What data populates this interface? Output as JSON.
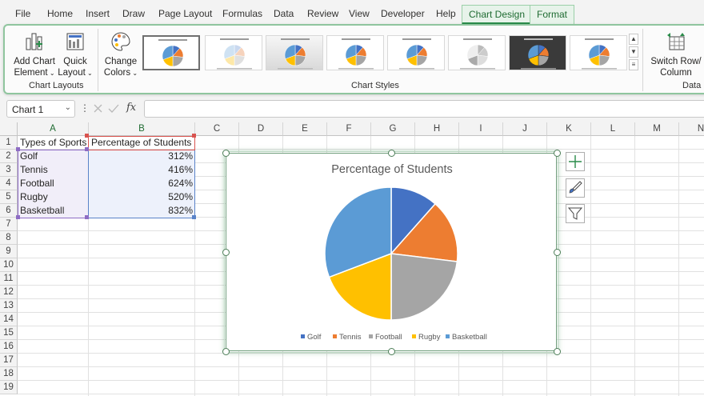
{
  "menu": {
    "tabs": [
      "File",
      "Home",
      "Insert",
      "Draw",
      "Page Layout",
      "Formulas",
      "Data",
      "Review",
      "View",
      "Developer",
      "Help"
    ],
    "context_tabs": [
      "Chart Design",
      "Format"
    ],
    "active_tab": "Chart Design"
  },
  "ribbon": {
    "add_chart_element": [
      "Add Chart",
      "Element"
    ],
    "quick_layout": [
      "Quick",
      "Layout"
    ],
    "change_colors": [
      "Change",
      "Colors"
    ],
    "switch_row_column": [
      "Switch Row/",
      "Column"
    ],
    "groups": {
      "chart_layouts": "Chart Layouts",
      "chart_styles": "Chart Styles",
      "data": "Data"
    },
    "style_count": 8,
    "selected_style": 1
  },
  "formula_bar": {
    "name_box": "Chart 1",
    "fx": "fx",
    "formula": ""
  },
  "sheet": {
    "columns": [
      "A",
      "B",
      "C",
      "D",
      "E",
      "F",
      "G",
      "H",
      "I",
      "J",
      "K",
      "L",
      "M",
      "N"
    ],
    "rows": [
      "1",
      "2",
      "3",
      "4",
      "5",
      "6",
      "7",
      "8",
      "9",
      "10",
      "11",
      "12",
      "13",
      "14",
      "15",
      "16",
      "17",
      "18",
      "19"
    ],
    "headers": [
      "Types of Sports",
      "Percentage of Students"
    ],
    "data": [
      {
        "sport": "Golf",
        "pct": "312%"
      },
      {
        "sport": "Tennis",
        "pct": "416%"
      },
      {
        "sport": "Football",
        "pct": "624%"
      },
      {
        "sport": "Rugby",
        "pct": "520%"
      },
      {
        "sport": "Basketball",
        "pct": "832%"
      }
    ]
  },
  "chart_data": {
    "type": "pie",
    "title": "Percentage of Students",
    "categories": [
      "Golf",
      "Tennis",
      "Football",
      "Rugby",
      "Basketball"
    ],
    "values": [
      312,
      416,
      624,
      520,
      832
    ],
    "colors": [
      "#4472c4",
      "#ed7d31",
      "#a5a5a5",
      "#ffc000",
      "#5b9bd5"
    ],
    "legend": "bottom"
  },
  "colors": {
    "context_tab_accent": "#2a8c4a",
    "selection_green": "#4d7e58"
  }
}
